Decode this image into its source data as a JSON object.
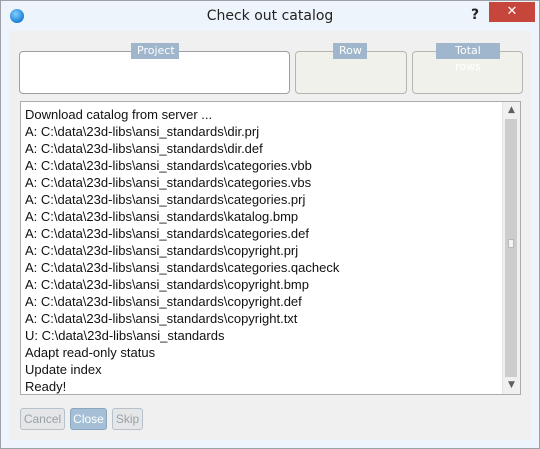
{
  "window": {
    "title": "Check out catalog",
    "help_label": "?",
    "close_label": "✕"
  },
  "groups": {
    "project": "Project",
    "row": "Row",
    "total_rows": "Total rows"
  },
  "log": {
    "lines": [
      "Download catalog from server ...",
      "A: C:\\data\\23d-libs\\ansi_standards\\dir.prj",
      "A: C:\\data\\23d-libs\\ansi_standards\\dir.def",
      "A: C:\\data\\23d-libs\\ansi_standards\\categories.vbb",
      "A: C:\\data\\23d-libs\\ansi_standards\\categories.vbs",
      "A: C:\\data\\23d-libs\\ansi_standards\\categories.prj",
      "A: C:\\data\\23d-libs\\ansi_standards\\katalog.bmp",
      "A: C:\\data\\23d-libs\\ansi_standards\\categories.def",
      "A: C:\\data\\23d-libs\\ansi_standards\\copyright.prj",
      "A: C:\\data\\23d-libs\\ansi_standards\\categories.qacheck",
      "A: C:\\data\\23d-libs\\ansi_standards\\copyright.bmp",
      "A: C:\\data\\23d-libs\\ansi_standards\\copyright.def",
      "A: C:\\data\\23d-libs\\ansi_standards\\copyright.txt",
      "U: C:\\data\\23d-libs\\ansi_standards",
      "Adapt read-only status",
      "Update index",
      "Ready!"
    ]
  },
  "buttons": {
    "cancel": "Cancel",
    "close": "Close",
    "skip": "Skip"
  },
  "colors": {
    "close_button": "#c7463c",
    "active_button": "#a4bfd6",
    "group_label": "#9fb6cc"
  }
}
